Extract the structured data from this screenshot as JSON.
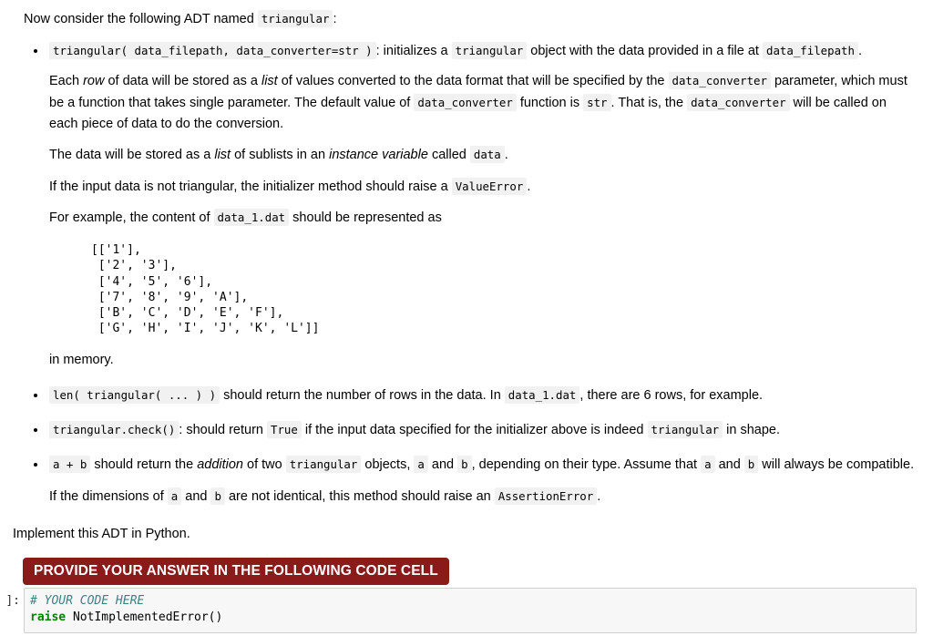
{
  "markdown": {
    "intro": {
      "before": "Now consider the following ADT named",
      "code": "triangular",
      "after": ":"
    },
    "bullets": [
      {
        "id": "constructor",
        "code_1": "triangular( data_filepath, data_converter=str )",
        "text_1": ": initializes a",
        "code_2": "triangular",
        "text_2": "object with the data provided in a file at",
        "code_3": "data_filepath",
        "text_3": ".",
        "sub_paragraphs": [
          {
            "id": "each-row",
            "segments": [
              {
                "type": "text",
                "value": "Each "
              },
              {
                "type": "italic",
                "value": "row"
              },
              {
                "type": "text",
                "value": " of data will be stored as a "
              },
              {
                "type": "italic",
                "value": "list"
              },
              {
                "type": "text",
                "value": " of values converted to the data format that will be specified by the "
              },
              {
                "type": "code",
                "value": "data_converter"
              },
              {
                "type": "text",
                "value": " parameter, which must be a function that takes single parameter. The default value of "
              },
              {
                "type": "code",
                "value": "data_converter"
              },
              {
                "type": "text",
                "value": " function is "
              },
              {
                "type": "code",
                "value": "str"
              },
              {
                "type": "text",
                "value": ". That is, the "
              },
              {
                "type": "code",
                "value": "data_converter"
              },
              {
                "type": "text",
                "value": " will be called on each piece of data to do the conversion."
              }
            ]
          },
          {
            "id": "stored-as-list",
            "segments": [
              {
                "type": "text",
                "value": "The data will be stored as a "
              },
              {
                "type": "italic",
                "value": "list"
              },
              {
                "type": "text",
                "value": " of sublists in an "
              },
              {
                "type": "italic",
                "value": "instance variable"
              },
              {
                "type": "text",
                "value": " called "
              },
              {
                "type": "code",
                "value": "data"
              },
              {
                "type": "text",
                "value": "."
              }
            ]
          },
          {
            "id": "value-error",
            "segments": [
              {
                "type": "text",
                "value": "If the input data is not triangular, the initializer method should raise a "
              },
              {
                "type": "code",
                "value": "ValueError"
              },
              {
                "type": "text",
                "value": "."
              }
            ]
          },
          {
            "id": "for-example",
            "segments": [
              {
                "type": "text",
                "value": "For example, the content of "
              },
              {
                "type": "code",
                "value": "data_1.dat"
              },
              {
                "type": "text",
                "value": " should be represented as"
              }
            ]
          }
        ],
        "data_block": "[['1'],\n ['2', '3'],\n ['4', '5', '6'],\n ['7', '8', '9', 'A'],\n ['B', 'C', 'D', 'E', 'F'],\n ['G', 'H', 'I', 'J', 'K', 'L']]",
        "after_block": "in memory."
      },
      {
        "id": "len",
        "segments": [
          {
            "type": "code",
            "value": "len( triangular( ... ) )"
          },
          {
            "type": "text",
            "value": " should return the number of rows in the data. In "
          },
          {
            "type": "code",
            "value": "data_1.dat"
          },
          {
            "type": "text",
            "value": ", there are 6 rows, for example."
          }
        ]
      },
      {
        "id": "check",
        "segments": [
          {
            "type": "code",
            "value": "triangular.check()"
          },
          {
            "type": "text",
            "value": ": should return "
          },
          {
            "type": "code",
            "value": "True"
          },
          {
            "type": "text",
            "value": " if the input data specified for the initializer above is indeed "
          },
          {
            "type": "code",
            "value": "triangular"
          },
          {
            "type": "text",
            "value": " in shape."
          }
        ]
      },
      {
        "id": "add",
        "segments": [
          {
            "type": "code",
            "value": "a + b"
          },
          {
            "type": "text",
            "value": " should return the "
          },
          {
            "type": "italic",
            "value": "addition"
          },
          {
            "type": "text",
            "value": " of two "
          },
          {
            "type": "code",
            "value": "triangular"
          },
          {
            "type": "text",
            "value": " objects, "
          },
          {
            "type": "code",
            "value": "a"
          },
          {
            "type": "text",
            "value": " and "
          },
          {
            "type": "code",
            "value": "b"
          },
          {
            "type": "text",
            "value": ", depending on their type. Assume that "
          },
          {
            "type": "code",
            "value": "a"
          },
          {
            "type": "text",
            "value": " and "
          },
          {
            "type": "code",
            "value": "b"
          },
          {
            "type": "text",
            "value": " will always be compatible."
          }
        ],
        "sub_paragraphs": [
          {
            "id": "assertion-error",
            "segments": [
              {
                "type": "text",
                "value": "If the dimensions of "
              },
              {
                "type": "code",
                "value": "a"
              },
              {
                "type": "text",
                "value": " and "
              },
              {
                "type": "code",
                "value": "b"
              },
              {
                "type": "text",
                "value": " are not identical, this method should raise an "
              },
              {
                "type": "code",
                "value": "AssertionError"
              },
              {
                "type": "text",
                "value": "."
              }
            ]
          }
        ]
      }
    ],
    "implement_note": "Implement this ADT in Python.",
    "banner": {
      "label": "PROVIDE YOUR ANSWER IN THE FOLLOWING CODE CELL",
      "background": "#8b1a1a",
      "color": "#ffffff"
    }
  },
  "code_cell": {
    "prompt": "]:",
    "lines": [
      {
        "tokens": [
          {
            "type": "comment",
            "value": "# YOUR CODE HERE"
          }
        ]
      },
      {
        "tokens": [
          {
            "type": "keyword",
            "value": "raise"
          },
          {
            "type": "name",
            "value": " NotImplementedError()"
          }
        ]
      }
    ],
    "colors": {
      "comment": "#408080",
      "keyword": "#008000",
      "background": "#f7f7f7",
      "border": "#cfcfcf"
    }
  }
}
